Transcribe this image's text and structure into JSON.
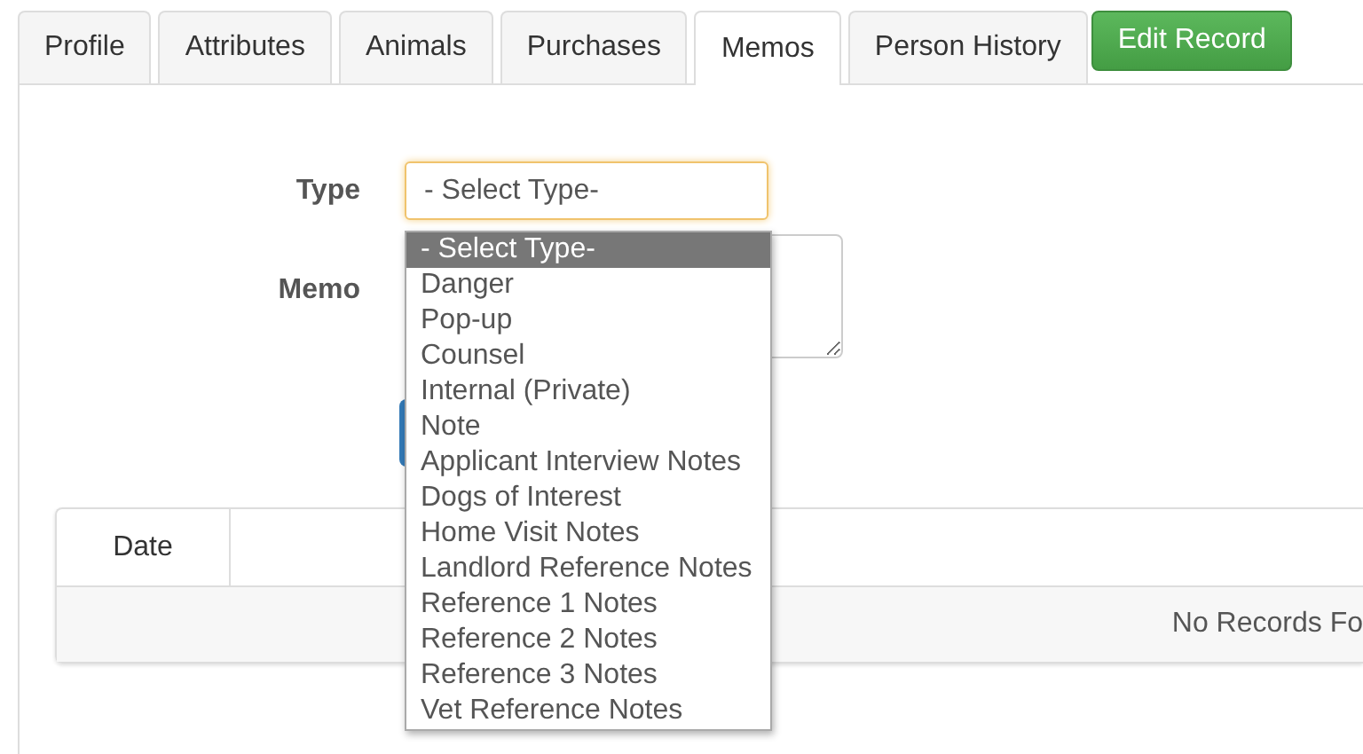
{
  "tabs": [
    {
      "label": "Profile",
      "selected": false
    },
    {
      "label": "Attributes",
      "selected": false
    },
    {
      "label": "Animals",
      "selected": false
    },
    {
      "label": "Purchases",
      "selected": false
    },
    {
      "label": "Memos",
      "selected": true
    },
    {
      "label": "Person History",
      "selected": false
    }
  ],
  "edit_button": "Edit Record",
  "form": {
    "type": {
      "label": "Type",
      "value": "- Select Type-",
      "options": [
        {
          "label": "- Select Type-",
          "selected": true
        },
        {
          "label": "Danger",
          "selected": false
        },
        {
          "label": "Pop-up",
          "selected": false
        },
        {
          "label": "Counsel",
          "selected": false
        },
        {
          "label": "Internal (Private)",
          "selected": false
        },
        {
          "label": "Note",
          "selected": false
        },
        {
          "label": "Applicant Interview Notes",
          "selected": false
        },
        {
          "label": "Dogs of Interest",
          "selected": false
        },
        {
          "label": "Home Visit Notes",
          "selected": false
        },
        {
          "label": "Landlord Reference Notes",
          "selected": false
        },
        {
          "label": "Reference 1 Notes",
          "selected": false
        },
        {
          "label": "Reference 2 Notes",
          "selected": false
        },
        {
          "label": "Reference 3 Notes",
          "selected": false
        },
        {
          "label": "Vet Reference Notes",
          "selected": false
        }
      ]
    },
    "memo": {
      "label": "Memo"
    }
  },
  "table": {
    "columns": [
      "Date"
    ],
    "empty_message": "No Records Fo"
  }
}
